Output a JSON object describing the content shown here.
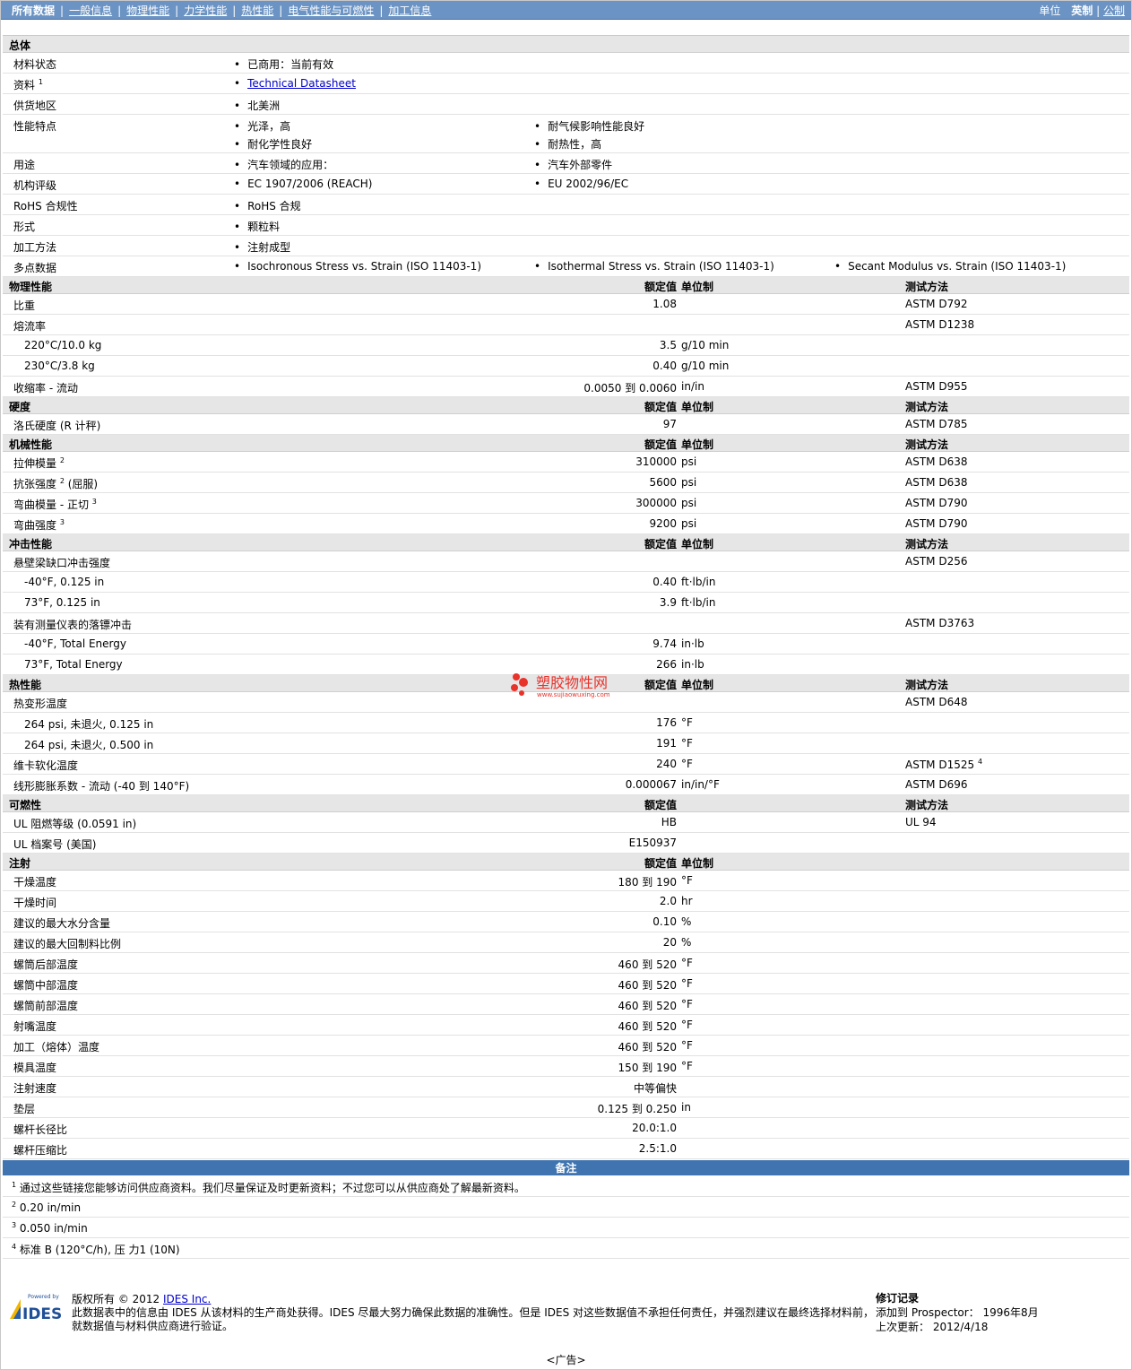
{
  "nav": {
    "tabs": [
      "所有数据",
      "一般信息",
      "物理性能",
      "力学性能",
      "热性能",
      "电气性能与可燃性",
      "加工信息"
    ],
    "units_label": "单位",
    "unit_active": "英制",
    "unit_other": "公制"
  },
  "col_headers": {
    "value": "额定值",
    "unit": "单位制",
    "test": "测试方法"
  },
  "general": {
    "title": "总体",
    "status_label": "材料状态",
    "status_value": "已商用：当前有效",
    "doc_label": "资料",
    "doc_sup": "1",
    "doc_value": "Technical Datasheet",
    "region_label": "供货地区",
    "region_value": "北美洲",
    "features_label": "性能特点",
    "features": [
      "光泽，高",
      "耐气候影响性能良好",
      "耐化学性良好",
      "耐热性，高"
    ],
    "uses_label": "用途",
    "uses": [
      "汽车领域的应用：",
      "汽车外部零件"
    ],
    "agency_label": "机构评级",
    "agency": [
      "EC 1907/2006 (REACH)",
      "EU 2002/96/EC"
    ],
    "rohs_label": "RoHS 合规性",
    "rohs_value": "RoHS 合规",
    "form_label": "形式",
    "form_value": "颗粒料",
    "proc_label": "加工方法",
    "proc_value": "注射成型",
    "multi_label": "多点数据",
    "multi": [
      "Isochronous Stress vs. Strain (ISO 11403-1)",
      "Isothermal Stress vs. Strain (ISO 11403-1)",
      "Secant Modulus vs. Strain (ISO 11403-1)"
    ]
  },
  "physical": {
    "title": "物理性能",
    "rows": [
      {
        "label": "比重",
        "value": "1.08",
        "unit": "",
        "test": "ASTM D792",
        "sub": false
      },
      {
        "label": "熔流率",
        "value": "",
        "unit": "",
        "test": "ASTM D1238",
        "sub": false
      },
      {
        "label": "220°C/10.0 kg",
        "value": "3.5",
        "unit": "g/10 min",
        "test": "",
        "sub": true
      },
      {
        "label": "230°C/3.8 kg",
        "value": "0.40",
        "unit": "g/10 min",
        "test": "",
        "sub": true
      },
      {
        "label": "收缩率 - 流动",
        "value": "0.0050 到 0.0060",
        "unit": "in/in",
        "test": "ASTM D955",
        "sub": false
      }
    ]
  },
  "hardness": {
    "title": "硬度",
    "rows": [
      {
        "label": "洛氏硬度 (R 计秤)",
        "value": "97",
        "unit": "",
        "test": "ASTM D785",
        "sub": false
      }
    ]
  },
  "mechanical": {
    "title": "机械性能",
    "rows": [
      {
        "label": "拉伸模量",
        "sup": "2",
        "after": "",
        "value": "310000",
        "unit": "psi",
        "test": "ASTM D638"
      },
      {
        "label": "抗张强度",
        "sup": "2",
        "after": " (屈服)",
        "value": "5600",
        "unit": "psi",
        "test": "ASTM D638"
      },
      {
        "label": "弯曲模量 - 正切",
        "sup": "3",
        "after": "",
        "value": "300000",
        "unit": "psi",
        "test": "ASTM D790"
      },
      {
        "label": "弯曲强度",
        "sup": "3",
        "after": "",
        "value": "9200",
        "unit": "psi",
        "test": "ASTM D790"
      }
    ]
  },
  "impact": {
    "title": "冲击性能",
    "rows": [
      {
        "label": "悬壁梁缺口冲击强度",
        "value": "",
        "unit": "",
        "test": "ASTM D256",
        "sub": false
      },
      {
        "label": "-40°F, 0.125 in",
        "value": "0.40",
        "unit": "ft·lb/in",
        "test": "",
        "sub": true
      },
      {
        "label": "73°F, 0.125 in",
        "value": "3.9",
        "unit": "ft·lb/in",
        "test": "",
        "sub": true
      },
      {
        "label": "装有测量仪表的落镖冲击",
        "value": "",
        "unit": "",
        "test": "ASTM D3763",
        "sub": false
      },
      {
        "label": "-40°F, Total Energy",
        "value": "9.74",
        "unit": "in·lb",
        "test": "",
        "sub": true
      },
      {
        "label": "73°F, Total Energy",
        "value": "266",
        "unit": "in·lb",
        "test": "",
        "sub": true
      }
    ]
  },
  "thermal": {
    "title": "热性能",
    "rows": [
      {
        "label": "热变形温度",
        "value": "",
        "unit": "",
        "test": "ASTM D648",
        "sub": false
      },
      {
        "label": "264 psi, 未退火, 0.125 in",
        "value": "176",
        "unit": "°F",
        "test": "",
        "sub": true
      },
      {
        "label": "264 psi, 未退火, 0.500 in",
        "value": "191",
        "unit": "°F",
        "test": "",
        "sub": true
      },
      {
        "label": "维卡软化温度",
        "value": "240",
        "unit": "°F",
        "test": "ASTM D1525",
        "test_sup": "4",
        "sub": false
      },
      {
        "label": "线形膨胀系数 - 流动 (-40 到 140°F)",
        "value": "0.000067",
        "unit": "in/in/°F",
        "test": "ASTM D696",
        "sub": false
      }
    ]
  },
  "flammability": {
    "title": "可燃性",
    "rows": [
      {
        "label": "UL 阻燃等级 (0.0591 in)",
        "value": "HB",
        "unit": "",
        "test": "UL 94",
        "sub": false
      },
      {
        "label": "UL 档案号 (美国)",
        "value": "E150937",
        "unit": "",
        "test": "",
        "sub": false
      }
    ]
  },
  "injection": {
    "title": "注射",
    "rows": [
      {
        "label": "干燥温度",
        "value": "180 到 190",
        "unit": "°F"
      },
      {
        "label": "干燥时间",
        "value": "2.0",
        "unit": "hr"
      },
      {
        "label": "建议的最大水分含量",
        "value": "0.10",
        "unit": "%"
      },
      {
        "label": "建议的最大回制料比例",
        "value": "20",
        "unit": "%"
      },
      {
        "label": "螺筒后部温度",
        "value": "460 到 520",
        "unit": "°F"
      },
      {
        "label": "螺筒中部温度",
        "value": "460 到 520",
        "unit": "°F"
      },
      {
        "label": "螺筒前部温度",
        "value": "460 到 520",
        "unit": "°F"
      },
      {
        "label": "射嘴温度",
        "value": "460 到 520",
        "unit": "°F"
      },
      {
        "label": "加工（熔体）温度",
        "value": "460 到 520",
        "unit": "°F"
      },
      {
        "label": "模具温度",
        "value": "150 到 190",
        "unit": "°F"
      },
      {
        "label": "注射速度",
        "value": "中等偏快",
        "unit": ""
      },
      {
        "label": "垫层",
        "value": "0.125 到 0.250",
        "unit": "in"
      },
      {
        "label": "螺杆长径比",
        "value": "20.0:1.0",
        "unit": ""
      },
      {
        "label": "螺杆压缩比",
        "value": "2.5:1.0",
        "unit": ""
      }
    ]
  },
  "notes": {
    "title": "备注",
    "items": [
      {
        "num": "1",
        "text": "通过这些链接您能够访问供应商资料。我们尽量保证及时更新资料；不过您可以从供应商处了解最新资料。"
      },
      {
        "num": "2",
        "text": "0.20 in/min"
      },
      {
        "num": "3",
        "text": "0.050 in/min"
      },
      {
        "num": "4",
        "text": "标准 B (120°C/h), 压 力1 (10N)"
      }
    ]
  },
  "footer": {
    "powered_by": "Powered by",
    "logo_text": "IDES",
    "copyright_prefix": "版权所有 © 2012 ",
    "copyright_link": "IDES Inc.",
    "disclaimer_1": "此数据表中的信息由 IDES 从该材料的生产商处获得。IDES 尽最大努力确保此数据的准确性。但是 IDES 对这些数据值不承担任何责任，并强烈建议在最终选择材料前，",
    "disclaimer_2": "就数据值与材料供应商进行验证。",
    "rev_title": "修订记录",
    "rev_added": "添加到 Prospector： 1996年8月",
    "rev_updated": "上次更新： 2012/4/18"
  },
  "watermark": {
    "text": "塑胶物性网",
    "url_text": "www.sujiaowuxing.com"
  },
  "ad_text": "<广告>"
}
